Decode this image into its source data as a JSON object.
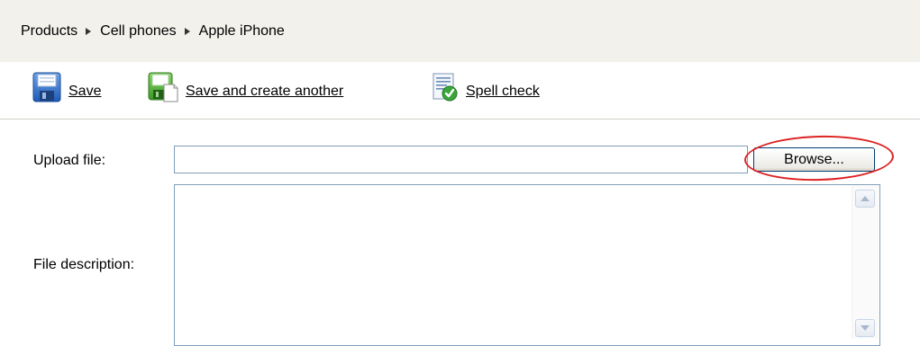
{
  "breadcrumb": {
    "items": [
      "Products",
      "Cell phones",
      "Apple iPhone"
    ]
  },
  "toolbar": {
    "save_label": "Save",
    "save_another_label": "Save and create another",
    "spell_check_label": "Spell check",
    "icons": {
      "save": "floppy-disk-icon",
      "save_another": "floppy-disk-new-page-icon",
      "spell_check": "document-check-icon"
    }
  },
  "form": {
    "upload_label": "Upload file:",
    "upload_value": "",
    "browse_label": "Browse...",
    "description_label": "File description:",
    "description_value": ""
  },
  "colors": {
    "breadcrumb_bg": "#f3f1ec",
    "highlight": "#dd2222",
    "input_border": "#7f9db9"
  }
}
